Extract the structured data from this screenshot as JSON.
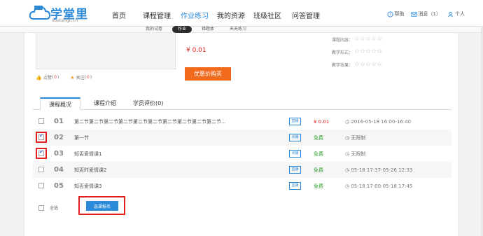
{
  "header": {
    "brand": "学堂里",
    "domain": "xuetangli.cn",
    "nav": [
      {
        "label": "首页",
        "active": false
      },
      {
        "label": "课程管理",
        "active": false
      },
      {
        "label": "作业练习",
        "active": true
      },
      {
        "label": "我的资源",
        "active": false
      },
      {
        "label": "班级社区",
        "active": false
      },
      {
        "label": "问答管理",
        "active": false
      }
    ],
    "help_label": "帮助",
    "messages_label": "消息（1）",
    "profile_label": "个人"
  },
  "subnav": [
    {
      "label": "我的试卷",
      "active": false
    },
    {
      "label": "作业",
      "active": true
    },
    {
      "label": "错题本",
      "active": false
    },
    {
      "label": "天天练习",
      "active": false
    }
  ],
  "course": {
    "likes_label": "点赞",
    "likes_count": "0",
    "follows_label": "关注",
    "follows_count": "0",
    "price": "¥ 0.01",
    "buy_label": "优惠价购买",
    "ratings": [
      {
        "label": "课程内容：",
        "stars": "☆☆☆☆☆"
      },
      {
        "label": "教学形式：",
        "stars": "☆☆☆☆☆"
      },
      {
        "label": "教学效果：",
        "stars": "☆☆☆☆☆"
      }
    ]
  },
  "tabs": [
    {
      "label": "课程概况",
      "active": true
    },
    {
      "label": "课程介绍",
      "active": false
    },
    {
      "label": "学员评价(0)",
      "active": false
    }
  ],
  "lessons": [
    {
      "num": "01",
      "title": "第二节第二节第二节第二节第二节第二节第二节第二节第二节第二节...",
      "tag": "直播",
      "price": "¥ 0.01",
      "free": false,
      "time": "2016-05-18 16:00-16:40",
      "checked": false,
      "highlight": false
    },
    {
      "num": "02",
      "title": "第一节",
      "tag": "点播",
      "price": "免费",
      "free": true,
      "time": "无限制",
      "checked": true,
      "highlight": true
    },
    {
      "num": "03",
      "title": "知否爱情课1",
      "tag": "点播",
      "price": "免费",
      "free": true,
      "time": "无限制",
      "checked": true,
      "highlight": true
    },
    {
      "num": "04",
      "title": "知否时爱情课2",
      "tag": "直播",
      "price": "免费",
      "free": true,
      "time": "05-18 17:37-05-26 12:33",
      "checked": false,
      "highlight": false
    },
    {
      "num": "05",
      "title": "知否爱情课3",
      "tag": "直播",
      "price": "免费",
      "free": true,
      "time": "05-18 17:00-05-18 17:45",
      "checked": false,
      "highlight": false
    }
  ],
  "select_all_label": "全选",
  "enroll_label": "选课报名",
  "colors": {
    "accent": "#2a8ad9",
    "price": "#e02020",
    "buy": "#f26b1d",
    "free": "#3aa33a",
    "highlight": "#e02020"
  }
}
